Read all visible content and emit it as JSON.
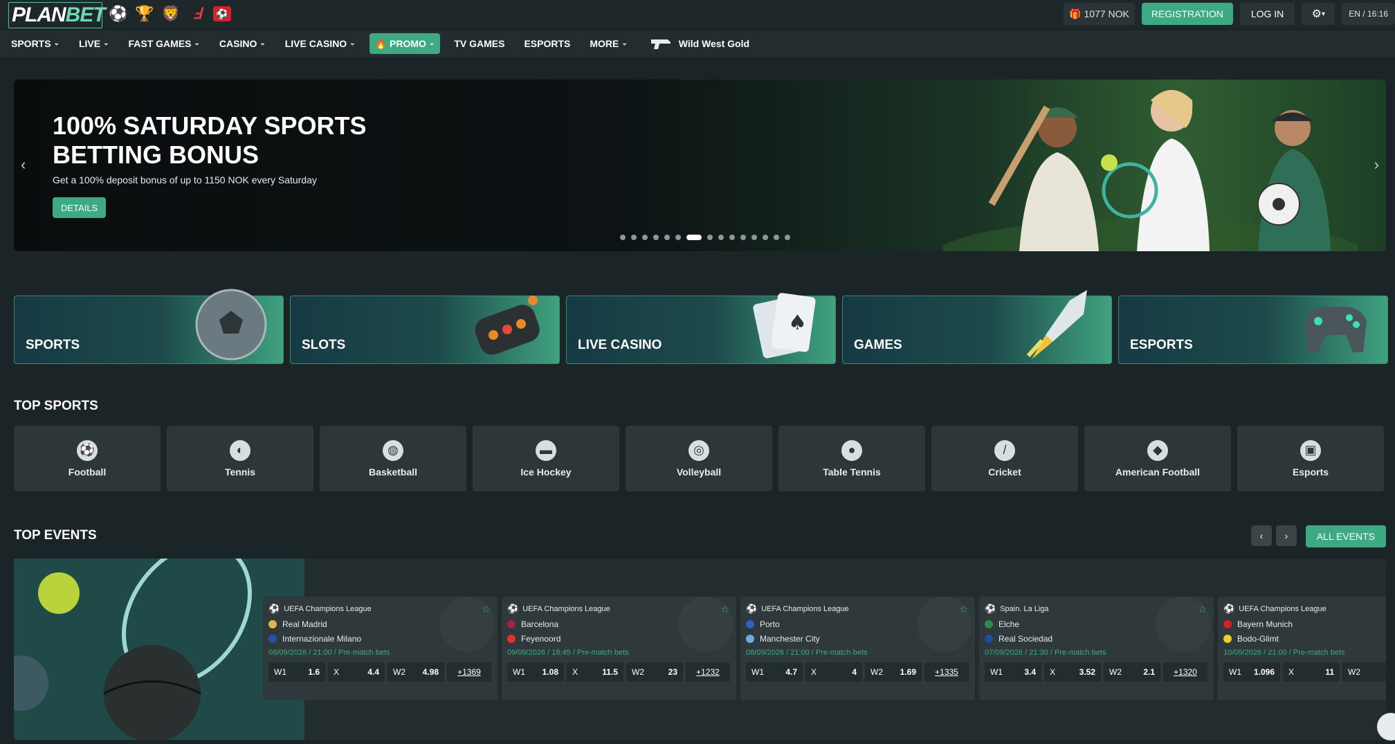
{
  "logo": {
    "plan": "PLAN",
    "bet": "BET"
  },
  "header": {
    "balance": "1077 NOK",
    "register_label": "REGISTRATION",
    "login_label": "LOG IN",
    "lang_time": "EN / 16:16"
  },
  "nav": {
    "items": [
      {
        "label": "SPORTS",
        "dropdown": true
      },
      {
        "label": "LIVE",
        "dropdown": true
      },
      {
        "label": "FAST GAMES",
        "dropdown": true
      },
      {
        "label": "CASINO",
        "dropdown": true
      },
      {
        "label": "LIVE CASINO",
        "dropdown": true
      },
      {
        "label": "PROMO",
        "dropdown": true,
        "highlight": true
      },
      {
        "label": "TV GAMES",
        "dropdown": false
      },
      {
        "label": "ESPORTS",
        "dropdown": false
      },
      {
        "label": "MORE",
        "dropdown": true
      }
    ],
    "featured_game": "Wild West Gold"
  },
  "banner": {
    "title": "100% SATURDAY SPORTS BETTING BONUS",
    "subtitle": "Get a 100% deposit bonus of up to 1150 NOK every Saturday",
    "button": "DETAILS",
    "slide_count": 15,
    "active_slide": 6
  },
  "categories": [
    {
      "label": "SPORTS",
      "icon": "soccer-ball-icon"
    },
    {
      "label": "SLOTS",
      "icon": "slot-reel-icon"
    },
    {
      "label": "LIVE CASINO",
      "icon": "playing-cards-icon"
    },
    {
      "label": "GAMES",
      "icon": "rocket-icon"
    },
    {
      "label": "ESPORTS",
      "icon": "gamepad-icon"
    }
  ],
  "top_sports": {
    "title": "TOP SPORTS",
    "items": [
      {
        "label": "Football",
        "glyph": "⚽"
      },
      {
        "label": "Tennis",
        "glyph": "◐"
      },
      {
        "label": "Basketball",
        "glyph": "◍"
      },
      {
        "label": "Ice Hockey",
        "glyph": "▬"
      },
      {
        "label": "Volleyball",
        "glyph": "◎"
      },
      {
        "label": "Table Tennis",
        "glyph": "●"
      },
      {
        "label": "Cricket",
        "glyph": "/"
      },
      {
        "label": "American Football",
        "glyph": "◆"
      },
      {
        "label": "Esports",
        "glyph": "▣"
      }
    ]
  },
  "top_events": {
    "title": "TOP EVENTS",
    "all_label": "ALL EVENTS",
    "events": [
      {
        "league": "UEFA Champions League",
        "team1": "Real Madrid",
        "team2": "Internazionale Milano",
        "c1": "#e0b84a",
        "c2": "#2a4ea0",
        "date": "08/09/2026 / 21:00 / Pre-match bets",
        "w1": "1.6",
        "x": "4.4",
        "w2": "4.98",
        "more": "+1369"
      },
      {
        "league": "UEFA Champions League",
        "team1": "Barcelona",
        "team2": "Feyenoord",
        "c1": "#a5204a",
        "c2": "#e03030",
        "date": "09/09/2026 / 18:45 / Pre-match bets",
        "w1": "1.08",
        "x": "11.5",
        "w2": "23",
        "more": "+1232"
      },
      {
        "league": "UEFA Champions League",
        "team1": "Porto",
        "team2": "Manchester City",
        "c1": "#2f5fbf",
        "c2": "#6cabdd",
        "date": "08/09/2026 / 21:00 / Pre-match bets",
        "w1": "4.7",
        "x": "4",
        "w2": "1.69",
        "more": "+1335"
      },
      {
        "league": "Spain. La Liga",
        "team1": "Elche",
        "team2": "Real Sociedad",
        "c1": "#2e8a4a",
        "c2": "#1c4fa0",
        "date": "07/09/2026 / 21:30 / Pre-match bets",
        "w1": "3.4",
        "x": "3.52",
        "w2": "2.1",
        "more": "+1320"
      },
      {
        "league": "UEFA Champions League",
        "team1": "Bayern Munich",
        "team2": "Bodo-Glimt",
        "c1": "#d0202a",
        "c2": "#e8d030",
        "date": "10/09/2026 / 21:00 / Pre-match bets",
        "w1": "1.096",
        "x": "11",
        "w2": "",
        "more": ""
      }
    ],
    "odd_labels": {
      "w1": "W1",
      "x": "X",
      "w2": "W2"
    }
  }
}
